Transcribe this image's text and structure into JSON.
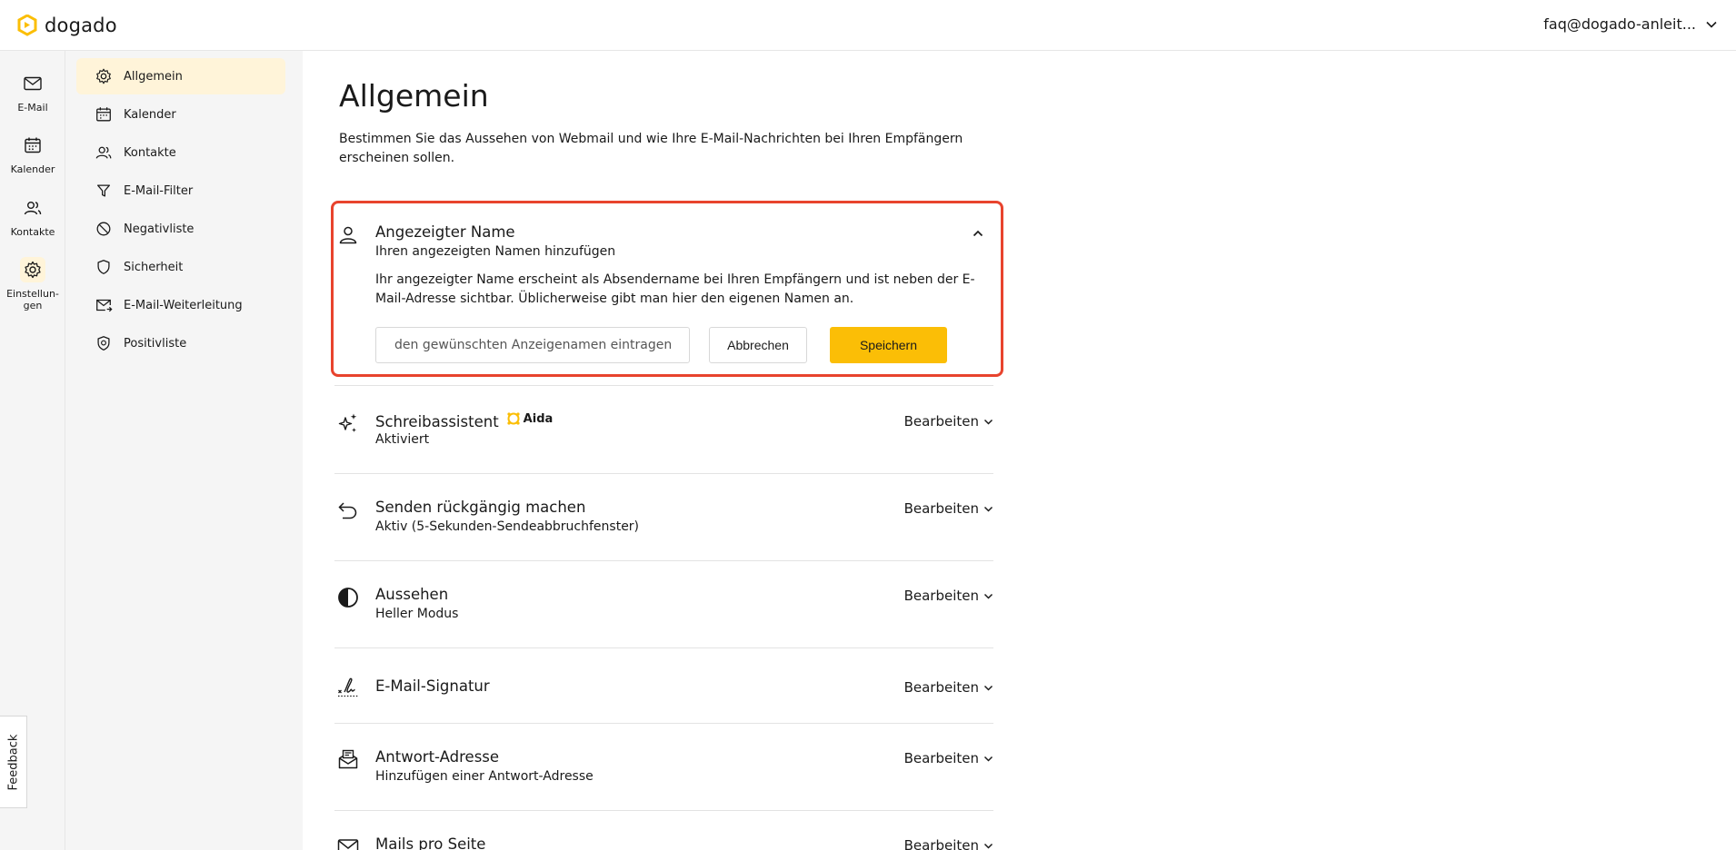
{
  "brand": {
    "name": "dogado",
    "accent": "#fbbe06",
    "highlight": "#e8432d"
  },
  "account": {
    "email": "faq@dogado-anleit..."
  },
  "rail": [
    {
      "label": "E-Mail",
      "icon": "mail-icon"
    },
    {
      "label": "Kalender",
      "icon": "calendar-icon"
    },
    {
      "label": "Kontakte",
      "icon": "contacts-icon"
    },
    {
      "label": "Einstellun-gen",
      "icon": "gear-icon",
      "active": true
    }
  ],
  "subnav": [
    {
      "label": "Allgemein",
      "icon": "gear-icon",
      "active": true
    },
    {
      "label": "Kalender",
      "icon": "calendar-icon"
    },
    {
      "label": "Kontakte",
      "icon": "contacts-icon"
    },
    {
      "label": "E-Mail-Filter",
      "icon": "filter-icon"
    },
    {
      "label": "Negativliste",
      "icon": "block-icon"
    },
    {
      "label": "Sicherheit",
      "icon": "shield-icon"
    },
    {
      "label": "E-Mail-Weiterleitung",
      "icon": "mail-forward-icon"
    },
    {
      "label": "Positivliste",
      "icon": "shield-check-icon"
    }
  ],
  "main": {
    "title": "Allgemein",
    "description": "Bestimmen Sie das Aussehen von Webmail und wie Ihre E-Mail-Nachrichten bei Ihren Empfängern erscheinen sollen.",
    "display_name": {
      "title": "Angezeigter Name",
      "subtitle": "Ihren angezeigten Namen hinzufügen",
      "text": "Ihr angezeigter Name erscheint als Absendername bei Ihren Empfängern und ist neben der E-Mail-Adresse sichtbar. Üblicherweise gibt man hier den eigenen Namen an.",
      "placeholder": "den gewünschten Anzeigenamen eintragen",
      "value": "",
      "cancel_label": "Abbrechen",
      "save_label": "Speichern"
    },
    "edit_label": "Bearbeiten",
    "sections": [
      {
        "title": "Schreibassistent",
        "badge": "Aida",
        "subtitle": "Aktiviert",
        "icon": "sparkle-icon"
      },
      {
        "title": "Senden rückgängig machen",
        "subtitle": "Aktiv (5-Sekunden-Sendeabbruchfenster)",
        "icon": "undo-icon"
      },
      {
        "title": "Aussehen",
        "subtitle": "Heller Modus",
        "icon": "contrast-icon"
      },
      {
        "title": "E-Mail-Signatur",
        "subtitle": "",
        "icon": "signature-icon"
      },
      {
        "title": "Antwort-Adresse",
        "subtitle": "Hinzufügen einer Antwort-Adresse",
        "icon": "reply-mailbox-icon"
      },
      {
        "title": "Mails pro Seite",
        "subtitle": "",
        "icon": "mail-icon"
      }
    ]
  },
  "feedback": {
    "label": "Feedback"
  }
}
